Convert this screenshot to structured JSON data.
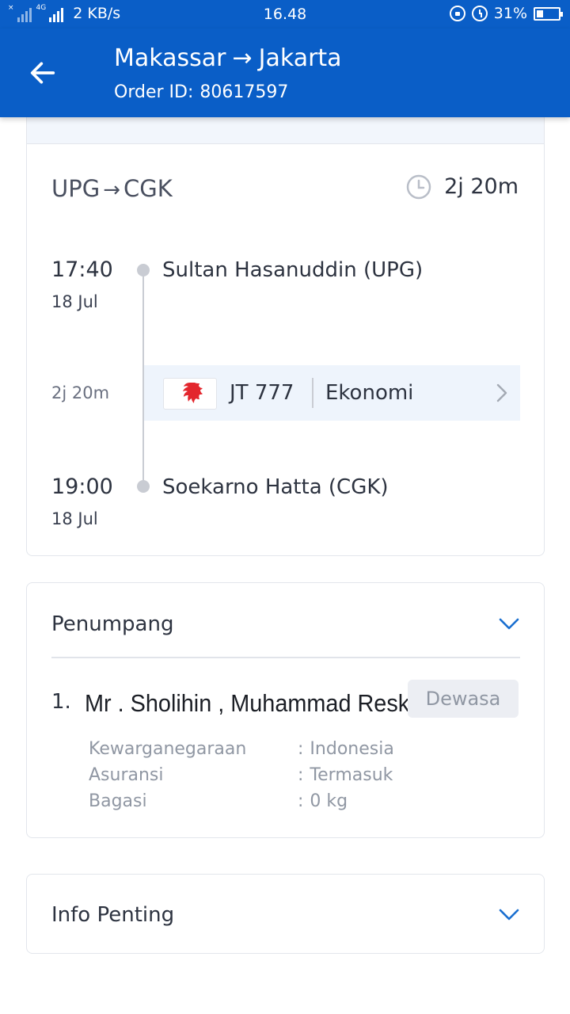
{
  "status_bar": {
    "network_type": "4G",
    "speed": "2 KB/s",
    "time": "16.48",
    "battery": "31%",
    "battery_level": 0.31
  },
  "header": {
    "origin_city": "Makassar",
    "arrow": "→",
    "destination_city": "Jakarta",
    "order_label": "Order ID:",
    "order_id": "80617597"
  },
  "flight": {
    "origin_code": "UPG",
    "destination_code": "CGK",
    "arrow": "→",
    "total_duration": "2j 20m",
    "departure": {
      "time": "17:40",
      "date": "18 Jul",
      "airport": "Sultan Hasanuddin (UPG)"
    },
    "segment_duration": "2j 20m",
    "segment": {
      "airline_icon": "lion-air-logo",
      "flight_number": "JT 777",
      "cabin": "Ekonomi"
    },
    "arrival": {
      "time": "19:00",
      "date": "18 Jul",
      "airport": "Soekarno Hatta (CGK)"
    }
  },
  "passengers": {
    "title": "Penumpang",
    "items": [
      {
        "number": "1.",
        "name": "Mr . Sholihin , Muhammad Reski",
        "type": "Dewasa",
        "details": [
          {
            "label": "Kewarganegaraan",
            "value": "Indonesia"
          },
          {
            "label": "Asuransi",
            "value": "Termasuk"
          },
          {
            "label": "Bagasi",
            "value": "0 kg"
          }
        ]
      }
    ]
  },
  "important_info": {
    "title": "Info Penting"
  },
  "colors": {
    "primary": "#0a5ec7",
    "accent_link": "#1a6fd0",
    "airline_red": "#e3262d"
  }
}
